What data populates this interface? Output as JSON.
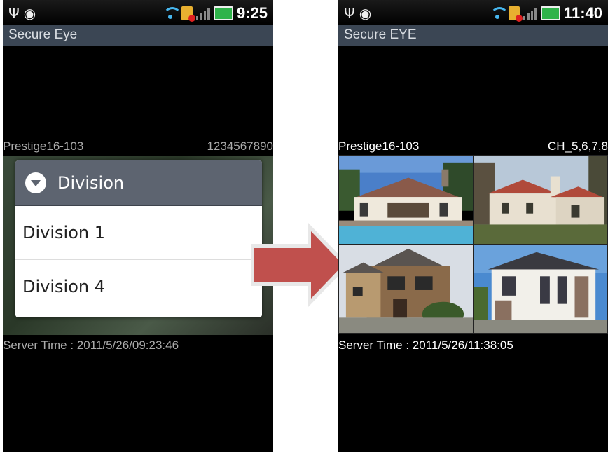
{
  "left": {
    "status": {
      "time": "9:25"
    },
    "title": "Secure Eye",
    "info": {
      "name": "Prestige16-103",
      "id": "1234567890"
    },
    "dialog": {
      "title": "Division",
      "items": [
        "Division 1",
        "Division 4"
      ]
    },
    "server_time": "Server Time : 2011/5/26/09:23:46"
  },
  "right": {
    "status": {
      "time": "11:40"
    },
    "title": "Secure EYE",
    "info": {
      "name": "Prestige16-103",
      "channels": "CH_5,6,7,8"
    },
    "server_time": "Server Time : 2011/5/26/11:38:05"
  },
  "colors": {
    "arrow": "#c0504d",
    "titlebar": "#3b4654",
    "dialog_header": "#5d6470"
  }
}
